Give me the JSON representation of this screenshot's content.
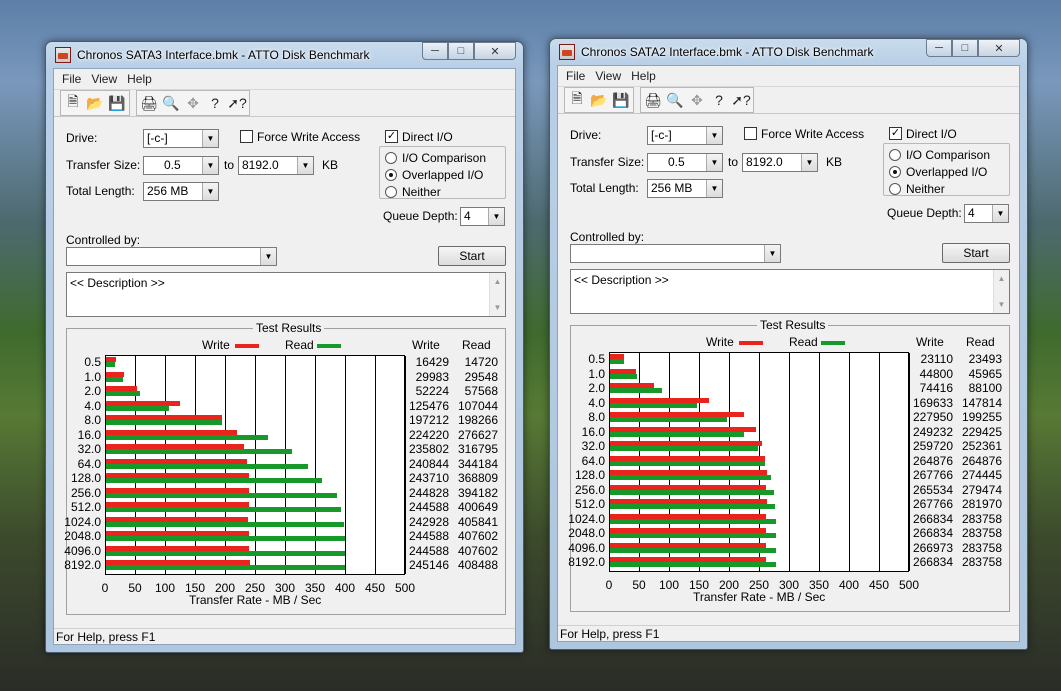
{
  "windows": [
    {
      "title": "Chronos SATA3 Interface.bmk - ATTO Disk Benchmark",
      "menu": [
        "File",
        "View",
        "Help"
      ],
      "drive_label": "Drive:",
      "drive_value": "[-c-]",
      "force_write_label": "Force Write Access",
      "force_write_checked": false,
      "direct_io_label": "Direct I/O",
      "direct_io_checked": true,
      "transfer_label": "Transfer Size:",
      "transfer_from": "0.5",
      "to_label": "to",
      "transfer_to": "8192.0",
      "kb_label": "KB",
      "total_label": "Total Length:",
      "total_value": "256 MB",
      "io_options": [
        "I/O Comparison",
        "Overlapped I/O",
        "Neither"
      ],
      "io_selected": 1,
      "queue_label": "Queue Depth:",
      "queue_value": "4",
      "controlled_label": "Controlled by:",
      "controlled_value": "",
      "start_label": "Start",
      "description": "<< Description >>",
      "results_title": "Test Results",
      "legend_write": "Write",
      "legend_read": "Read",
      "col_write": "Write",
      "col_read": "Read",
      "xaxis_title": "Transfer Rate - MB / Sec",
      "status": "For Help, press F1",
      "chart_data": {
        "type": "bar",
        "title": "Test Results",
        "xlabel": "Transfer Rate - MB / Sec",
        "xlim": [
          0,
          500
        ],
        "xticks": [
          "0",
          "50",
          "100",
          "150",
          "200",
          "250",
          "300",
          "350",
          "400",
          "450",
          "500"
        ],
        "categories": [
          "0.5",
          "1.0",
          "2.0",
          "4.0",
          "8.0",
          "16.0",
          "32.0",
          "64.0",
          "128.0",
          "256.0",
          "512.0",
          "1024.0",
          "2048.0",
          "4096.0",
          "8192.0"
        ],
        "series": [
          {
            "name": "Write",
            "color": "#e8241c",
            "values": [
              16429,
              29983,
              52224,
              125476,
              197212,
              224220,
              235802,
              240844,
              243710,
              244828,
              244588,
              242928,
              244588,
              244588,
              245146
            ]
          },
          {
            "name": "Read",
            "color": "#17992a",
            "values": [
              14720,
              29548,
              57568,
              107044,
              198266,
              276627,
              316795,
              344184,
              368809,
              394182,
              400649,
              405841,
              407602,
              407602,
              408488
            ]
          }
        ]
      }
    },
    {
      "title": "Chronos SATA2 Interface.bmk - ATTO Disk Benchmark",
      "menu": [
        "File",
        "View",
        "Help"
      ],
      "drive_label": "Drive:",
      "drive_value": "[-c-]",
      "force_write_label": "Force Write Access",
      "force_write_checked": false,
      "direct_io_label": "Direct I/O",
      "direct_io_checked": true,
      "transfer_label": "Transfer Size:",
      "transfer_from": "0.5",
      "to_label": "to",
      "transfer_to": "8192.0",
      "kb_label": "KB",
      "total_label": "Total Length:",
      "total_value": "256 MB",
      "io_options": [
        "I/O Comparison",
        "Overlapped I/O",
        "Neither"
      ],
      "io_selected": 1,
      "queue_label": "Queue Depth:",
      "queue_value": "4",
      "controlled_label": "Controlled by:",
      "controlled_value": "",
      "start_label": "Start",
      "description": "<< Description >>",
      "results_title": "Test Results",
      "legend_write": "Write",
      "legend_read": "Read",
      "col_write": "Write",
      "col_read": "Read",
      "xaxis_title": "Transfer Rate - MB / Sec",
      "status": "For Help, press F1",
      "chart_data": {
        "type": "bar",
        "title": "Test Results",
        "xlabel": "Transfer Rate - MB / Sec",
        "xlim": [
          0,
          500
        ],
        "xticks": [
          "0",
          "50",
          "100",
          "150",
          "200",
          "250",
          "300",
          "350",
          "400",
          "450",
          "500"
        ],
        "categories": [
          "0.5",
          "1.0",
          "2.0",
          "4.0",
          "8.0",
          "16.0",
          "32.0",
          "64.0",
          "128.0",
          "256.0",
          "512.0",
          "1024.0",
          "2048.0",
          "4096.0",
          "8192.0"
        ],
        "series": [
          {
            "name": "Write",
            "color": "#e8241c",
            "values": [
              23110,
              44800,
              74416,
              169633,
              227950,
              249232,
              259720,
              264876,
              267766,
              265534,
              267766,
              266834,
              266834,
              266973,
              266834
            ]
          },
          {
            "name": "Read",
            "color": "#17992a",
            "values": [
              23493,
              45965,
              88100,
              147814,
              199255,
              229425,
              252361,
              264876,
              274445,
              279474,
              281970,
              283758,
              283758,
              283758,
              283758
            ]
          }
        ]
      }
    }
  ]
}
